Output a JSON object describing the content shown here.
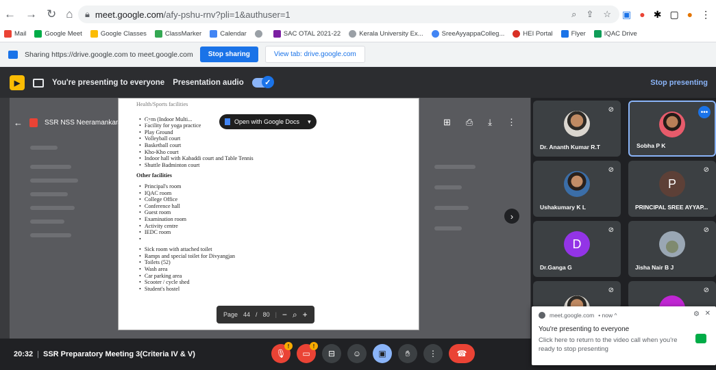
{
  "browser": {
    "url_host": "meet.google.com",
    "url_path": "/afy-pshu-rnv?pli=1&authuser=1",
    "bookmarks": [
      {
        "label": "Mail",
        "color": "#ea4335"
      },
      {
        "label": "Google Meet",
        "color": "#00ac47"
      },
      {
        "label": "Google Classes",
        "color": "#fbbc04"
      },
      {
        "label": "ClassMarker",
        "color": "#34a853"
      },
      {
        "label": "Calendar",
        "color": "#4285f4"
      },
      {
        "label": "",
        "color": "#9aa0a6"
      },
      {
        "label": "SAC OTAL 2021-22",
        "color": "#7b1fa2"
      },
      {
        "label": "Kerala University Ex...",
        "color": "#9aa0a6"
      },
      {
        "label": "SreeAyyappaColleg...",
        "color": "#4285f4"
      },
      {
        "label": "HEI Portal",
        "color": "#d93025"
      },
      {
        "label": "Flyer",
        "color": "#1a73e8"
      },
      {
        "label": "IQAC Drive",
        "color": "#0f9d58"
      }
    ]
  },
  "sharebar": {
    "text": "Sharing https://drive.google.com to meet.google.com",
    "stop_label": "Stop sharing",
    "view_label": "View tab: drive.google.com"
  },
  "presbar": {
    "presenting_text": "You're presenting to everyone",
    "audio_label": "Presentation audio",
    "stop_label": "Stop presenting"
  },
  "viewer": {
    "filename": "SSR NSS Neeramankara-2022.pdf",
    "open_with": "Open with Google Docs",
    "page_label": "Page",
    "page_current": "44",
    "page_sep": "/",
    "page_total": "80"
  },
  "pdf": {
    "top_heading": "Health/Sports facilities",
    "sports": [
      "Gym (Indoor Multi...",
      "Facility for yoga practice",
      "Play Ground",
      "Volleyball court",
      "Basketball court",
      "Kho-Kho court",
      "Indoor hall with Kabaddi court and Table Tennis",
      "Shuttle Badminton court"
    ],
    "other_heading": "Other facilities",
    "other": [
      "Principal's room",
      "IQAC room",
      "College Office",
      "Conference hall",
      "Guest room",
      "Examination room",
      "Activity centre",
      "IEDC room",
      ""
    ],
    "other2": [
      "Sick room with attached toilet",
      "Ramps and special toilet for Divyangjan",
      "Toilets (52)",
      "Wash area",
      "Car parking area",
      "Scooter / cycle shed",
      "Student's hostel"
    ]
  },
  "participants": [
    {
      "name": "Dr. Ananth Kumar R.T",
      "avatar": "photo",
      "letter": ""
    },
    {
      "name": "Sobha P K",
      "avatar": "photo2",
      "letter": "",
      "active": true
    },
    {
      "name": "Ushakumary K L",
      "avatar": "photo3",
      "letter": ""
    },
    {
      "name": "PRINCIPAL SREE AYYAP...",
      "avatar": "letter",
      "letter": "P",
      "color": "#5d4037"
    },
    {
      "name": "Dr.Ganga G",
      "avatar": "letter",
      "letter": "D",
      "color": "#9334e6"
    },
    {
      "name": "Jisha Nair B J",
      "avatar": "photo4",
      "letter": ""
    }
  ],
  "meeting": {
    "time": "20:32",
    "separator": "|",
    "title": "SSR Preparatory Meeting 3(Criteria IV & V)"
  },
  "notification": {
    "source": "meet.google.com",
    "when": "• now ^",
    "title": "You're presenting to everyone",
    "body": "Click here to return to the video call when you're ready to stop presenting"
  },
  "colors": {
    "accent": "#1a73e8",
    "danger": "#ea4335",
    "meet_bg": "#202124"
  }
}
